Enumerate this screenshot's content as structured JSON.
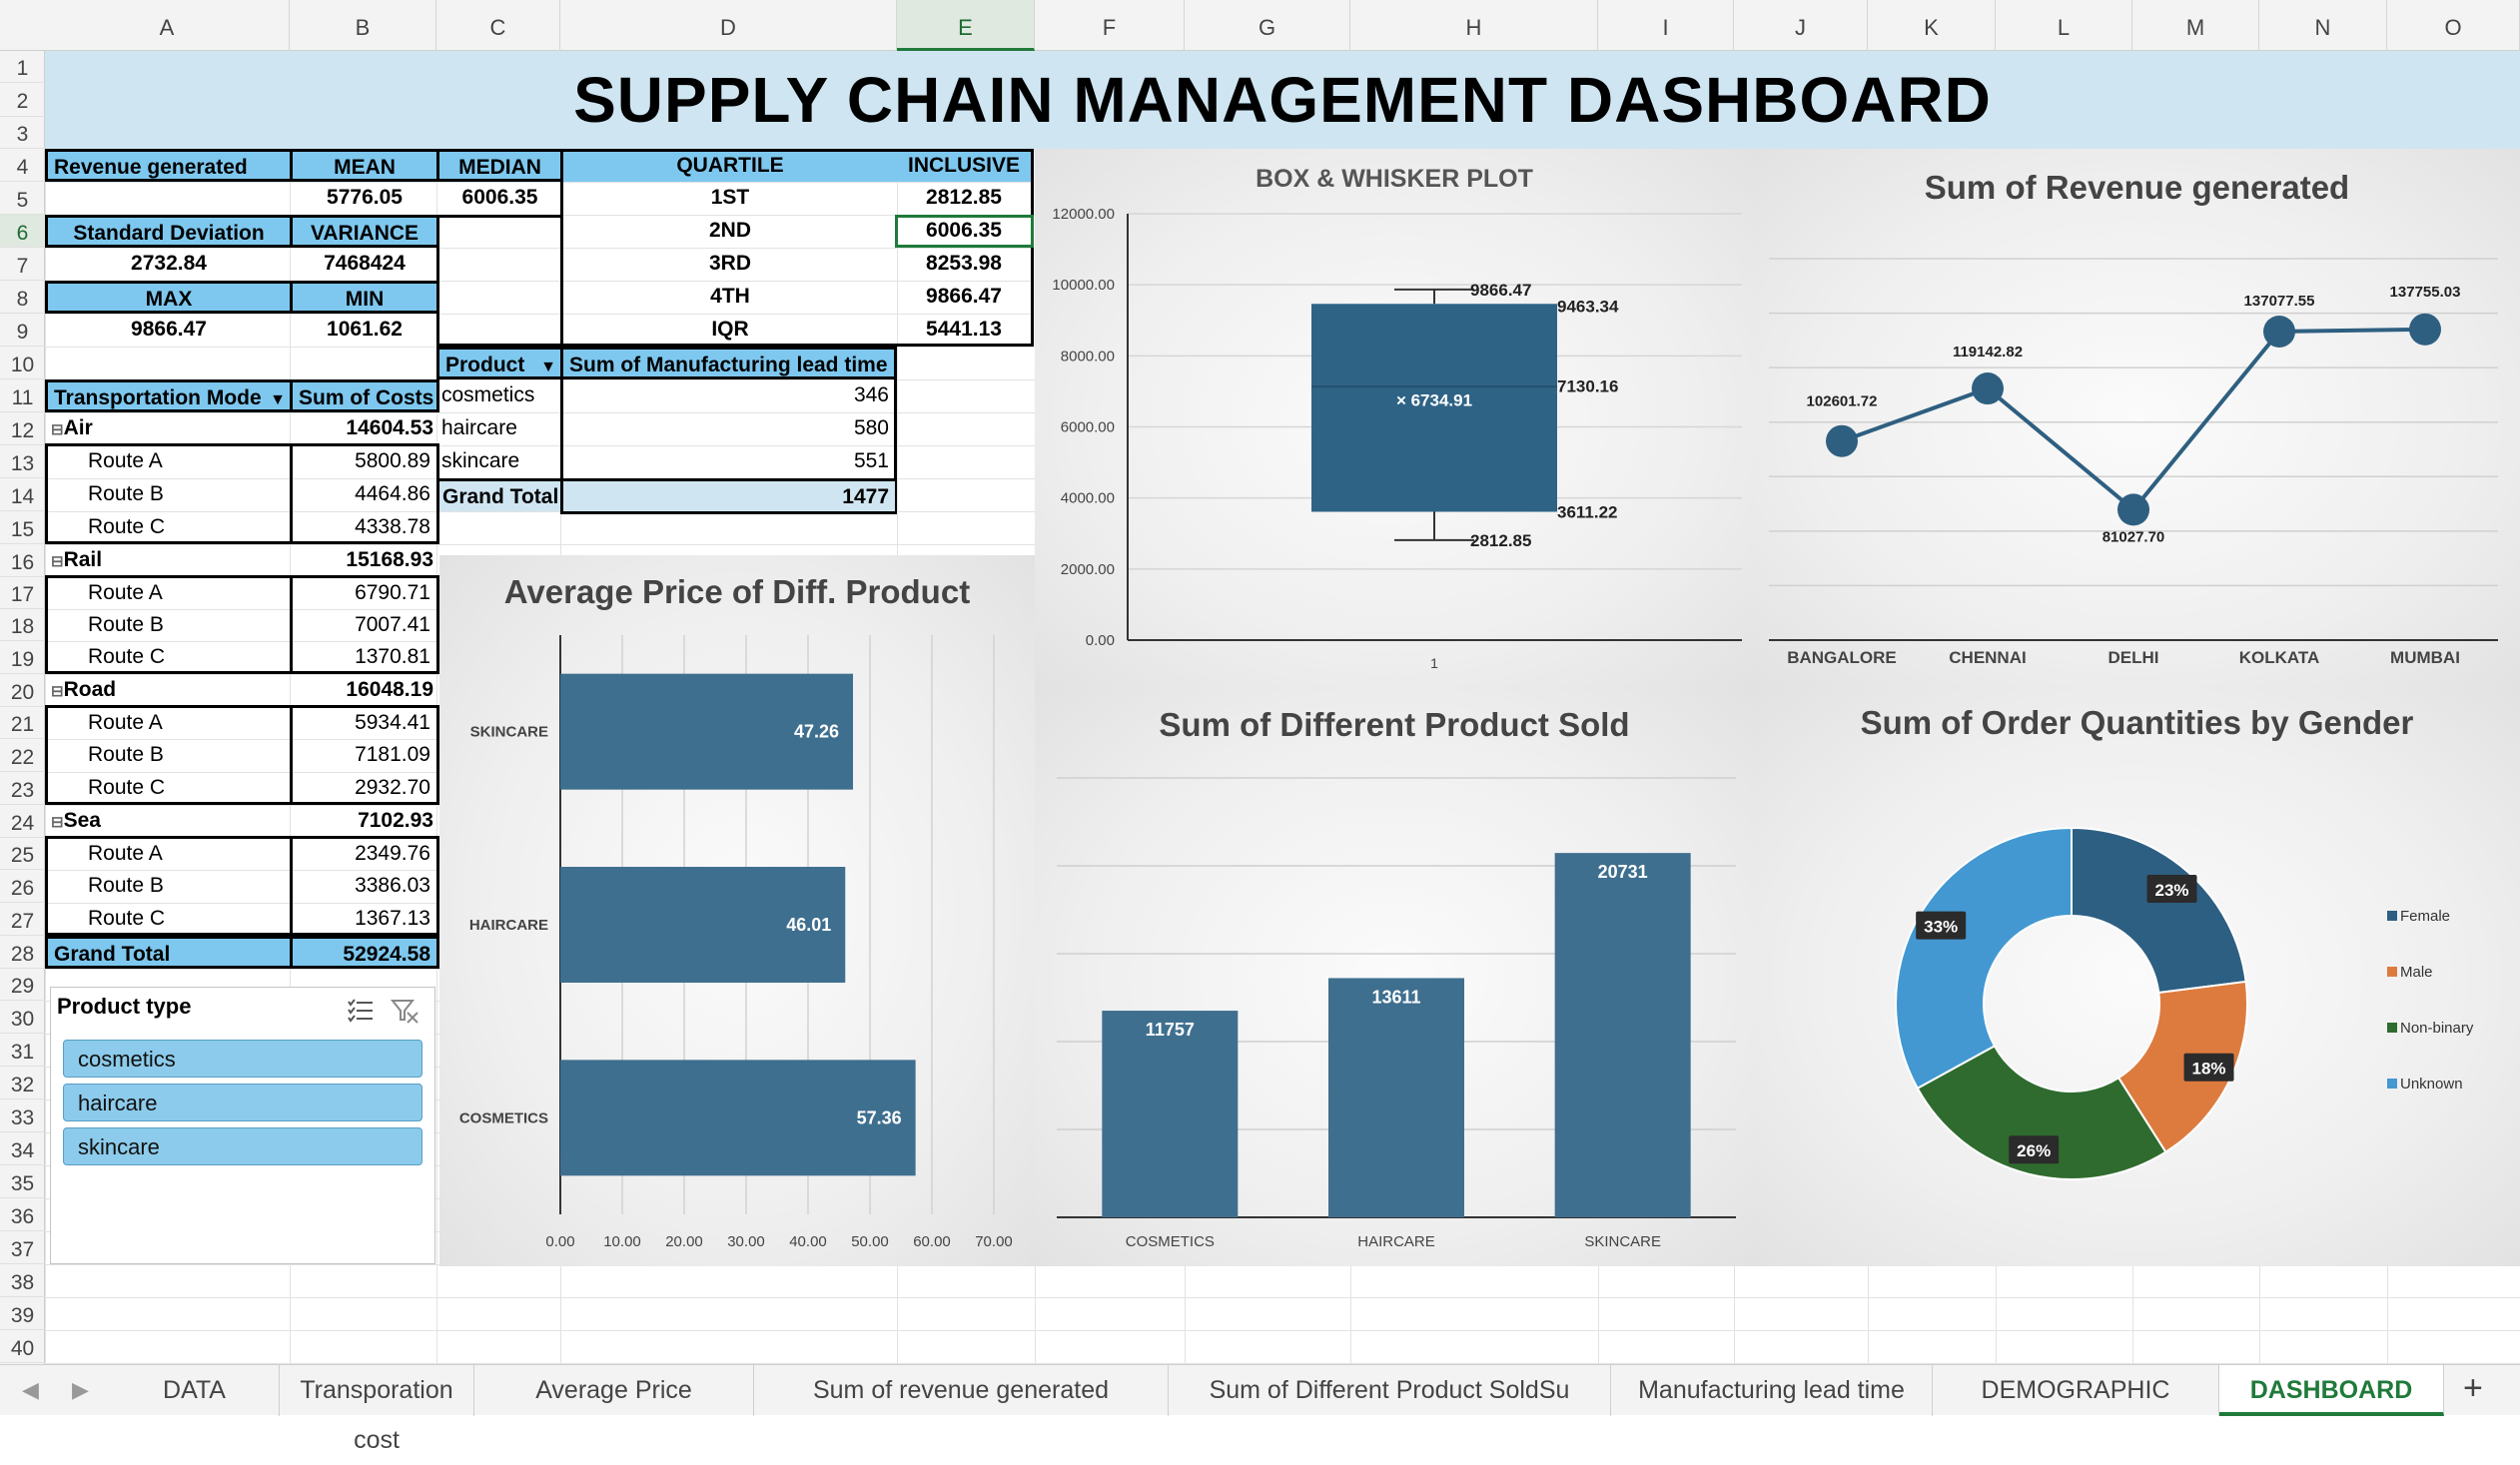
{
  "columns": [
    "A",
    "B",
    "C",
    "D",
    "E",
    "F",
    "G",
    "H",
    "I",
    "J",
    "K",
    "L",
    "M",
    "N",
    "O"
  ],
  "rows": [
    "1",
    "2",
    "3",
    "4",
    "5",
    "6",
    "7",
    "8",
    "9",
    "10",
    "11",
    "12",
    "13",
    "14",
    "15",
    "16",
    "17",
    "18",
    "19",
    "20",
    "21",
    "22",
    "23",
    "24",
    "25",
    "26",
    "27",
    "28",
    "29",
    "30",
    "31",
    "32",
    "33",
    "34",
    "35",
    "36",
    "37",
    "38",
    "39",
    "40"
  ],
  "title": "SUPPLY CHAIN MANAGEMENT DASHBOARD",
  "stats": {
    "revenue_label": "Revenue generated",
    "mean_label": "MEAN",
    "median_label": "MEDIAN",
    "mean": "5776.05",
    "median": "6006.35",
    "sd_label": "Standard Deviation",
    "var_label": "VARIANCE",
    "sd": "2732.84",
    "var": "7468424",
    "max_label": "MAX",
    "min_label": "MIN",
    "max": "9866.47",
    "min": "1061.62"
  },
  "quartiles": {
    "quartile_label": "QUARTILE",
    "inclusive_label": "INCLUSIVE",
    "rows": [
      {
        "q": "1ST",
        "v": "2812.85"
      },
      {
        "q": "2ND",
        "v": "6006.35"
      },
      {
        "q": "3RD",
        "v": "8253.98"
      },
      {
        "q": "4TH",
        "v": "9866.47"
      },
      {
        "q": "IQR",
        "v": "5441.13"
      }
    ]
  },
  "lead_time": {
    "product_label": "Product",
    "sum_label": "Sum of Manufacturing lead time",
    "rows": [
      {
        "p": "cosmetics",
        "v": "346"
      },
      {
        "p": "haircare",
        "v": "580"
      },
      {
        "p": "skincare",
        "v": "551"
      }
    ],
    "total_label": "Grand Total",
    "total": "1477"
  },
  "transport": {
    "mode_label": "Transportation Mode",
    "cost_label": "Sum of Costs",
    "groups": [
      {
        "name": "Air",
        "total": "14604.53",
        "routes": [
          {
            "r": "Route A",
            "v": "5800.89"
          },
          {
            "r": "Route B",
            "v": "4464.86"
          },
          {
            "r": "Route C",
            "v": "4338.78"
          }
        ]
      },
      {
        "name": "Rail",
        "total": "15168.93",
        "routes": [
          {
            "r": "Route A",
            "v": "6790.71"
          },
          {
            "r": "Route B",
            "v": "7007.41"
          },
          {
            "r": "Route C",
            "v": "1370.81"
          }
        ]
      },
      {
        "name": "Road",
        "total": "16048.19",
        "routes": [
          {
            "r": "Route A",
            "v": "5934.41"
          },
          {
            "r": "Route B",
            "v": "7181.09"
          },
          {
            "r": "Route C",
            "v": "2932.70"
          }
        ]
      },
      {
        "name": "Sea",
        "total": "7102.93",
        "routes": [
          {
            "r": "Route A",
            "v": "2349.76"
          },
          {
            "r": "Route B",
            "v": "3386.03"
          },
          {
            "r": "Route C",
            "v": "1367.13"
          }
        ]
      }
    ],
    "total_label": "Grand Total",
    "total": "52924.58"
  },
  "slicer": {
    "title": "Product type",
    "items": [
      "cosmetics",
      "haircare",
      "skincare"
    ]
  },
  "chart_data": [
    {
      "type": "bar",
      "orientation": "horizontal",
      "title": "Average Price of Diff. Product",
      "categories": [
        "SKINCARE",
        "HAIRCARE",
        "COSMETICS"
      ],
      "values": [
        47.26,
        46.01,
        57.36
      ],
      "value_labels": [
        "47.26",
        "46.01",
        "57.36"
      ],
      "xlim": [
        0,
        70
      ],
      "ticks": [
        "0.00",
        "10.00",
        "20.00",
        "30.00",
        "40.00",
        "50.00",
        "60.00",
        "70.00"
      ],
      "color": "#3f6f8f"
    },
    {
      "type": "box",
      "title": "BOX & WHISKER PLOT",
      "category": "1",
      "min": 2812.85,
      "q1": 3611.22,
      "median": 7130.16,
      "q3": 9463.34,
      "max": 9866.47,
      "mean": 6734.91,
      "labels": [
        "9866.47",
        "9463.34",
        "6734.91",
        "7130.16",
        "3611.22",
        "2812.85"
      ],
      "ylim": [
        0,
        12000
      ],
      "ticks": [
        "0.00",
        "2000.00",
        "4000.00",
        "6000.00",
        "8000.00",
        "10000.00",
        "12000.00"
      ],
      "color": "#2e6386"
    },
    {
      "type": "line",
      "title": "Sum of Revenue generated",
      "categories": [
        "BANGALORE",
        "CHENNAI",
        "DELHI",
        "KOLKATA",
        "MUMBAI"
      ],
      "values": [
        102601.72,
        119142.82,
        81027.7,
        137077.55,
        137755.03
      ],
      "value_labels": [
        "102601.72",
        "119142.82",
        "81027.70",
        "137077.55",
        "137755.03"
      ],
      "color": "#2e5f80"
    },
    {
      "type": "bar",
      "title": "Sum of Different Product Sold",
      "categories": [
        "COSMETICS",
        "HAIRCARE",
        "SKINCARE"
      ],
      "values": [
        11757,
        13611,
        20731
      ],
      "value_labels": [
        "11757",
        "13611",
        "20731"
      ],
      "color": "#3f6f8f"
    },
    {
      "type": "pie",
      "donut": true,
      "title": "Sum of Order Quantities by Gender",
      "labels": [
        "Female",
        "Male",
        "Non-binary",
        "Unknown"
      ],
      "values": [
        23,
        18,
        26,
        33
      ],
      "value_labels": [
        "23%",
        "18%",
        "26%",
        "33%"
      ],
      "colors": [
        "#2d5f82",
        "#dd7b3f",
        "#2f6b2f",
        "#4398d2"
      ],
      "legend": "right"
    }
  ],
  "tabs": [
    "DATA",
    "Transporation cost",
    "Average Price",
    "Sum of revenue generated",
    "Sum of Different Product SoldSu",
    "Manufacturing lead time",
    "DEMOGRAPHIC",
    "DASHBOARD"
  ],
  "active_tab": "DASHBOARD",
  "add_sheet": "+"
}
